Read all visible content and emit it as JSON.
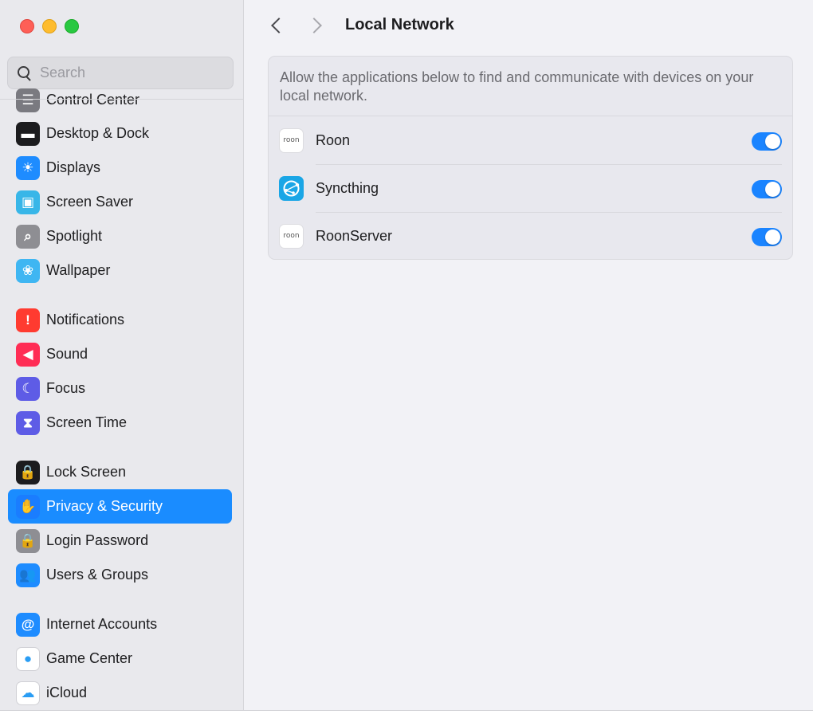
{
  "window": {
    "controls": [
      "close",
      "minimize",
      "maximize"
    ]
  },
  "sidebar": {
    "search": {
      "placeholder": "Search",
      "value": ""
    },
    "items": [
      {
        "label": "Control Center",
        "icon": "control-center-icon",
        "color": "#7a7a80",
        "selected": false
      },
      {
        "label": "Desktop & Dock",
        "icon": "dock-icon",
        "color": "#1c1c1e",
        "selected": false
      },
      {
        "label": "Displays",
        "icon": "displays-icon",
        "color": "#1e8cff",
        "selected": false
      },
      {
        "label": "Screen Saver",
        "icon": "screen-saver-icon",
        "color": "#38b6e8",
        "selected": false
      },
      {
        "label": "Spotlight",
        "icon": "spotlight-icon",
        "color": "#8e8e93",
        "selected": false
      },
      {
        "label": "Wallpaper",
        "icon": "wallpaper-icon",
        "color": "#3fb6f2",
        "selected": false
      },
      {
        "label": "Notifications",
        "icon": "notifications-icon",
        "color": "#ff3b30",
        "selected": false
      },
      {
        "label": "Sound",
        "icon": "sound-icon",
        "color": "#ff2d55",
        "selected": false
      },
      {
        "label": "Focus",
        "icon": "focus-icon",
        "color": "#5e5ce6",
        "selected": false
      },
      {
        "label": "Screen Time",
        "icon": "screen-time-icon",
        "color": "#5e5ce6",
        "selected": false
      },
      {
        "label": "Lock Screen",
        "icon": "lock-screen-icon",
        "color": "#1c1c1e",
        "selected": false
      },
      {
        "label": "Privacy & Security",
        "icon": "hand-icon",
        "color": "#1a7dff",
        "selected": true
      },
      {
        "label": "Login Password",
        "icon": "login-password-icon",
        "color": "#8e8e93",
        "selected": false
      },
      {
        "label": "Users & Groups",
        "icon": "users-groups-icon",
        "color": "#1e8cff",
        "selected": false
      },
      {
        "label": "Internet Accounts",
        "icon": "at-sign-icon",
        "color": "#1e8cff",
        "selected": false
      },
      {
        "label": "Game Center",
        "icon": "game-center-icon",
        "color": "#ffffff",
        "selected": false
      },
      {
        "label": "iCloud",
        "icon": "icloud-icon",
        "color": "#ffffff",
        "selected": false
      }
    ]
  },
  "header": {
    "title": "Local Network"
  },
  "main": {
    "description": "Allow the applications below to find and communicate with devices on your local network.",
    "apps": [
      {
        "name": "Roon",
        "icon": "roon-icon",
        "icon_text": "roon",
        "enabled": true
      },
      {
        "name": "Syncthing",
        "icon": "syncthing-icon",
        "enabled": true
      },
      {
        "name": "RoonServer",
        "icon": "roon-server-icon",
        "icon_text": "roon",
        "enabled": true
      }
    ],
    "accent_color": "#1a84ff"
  }
}
